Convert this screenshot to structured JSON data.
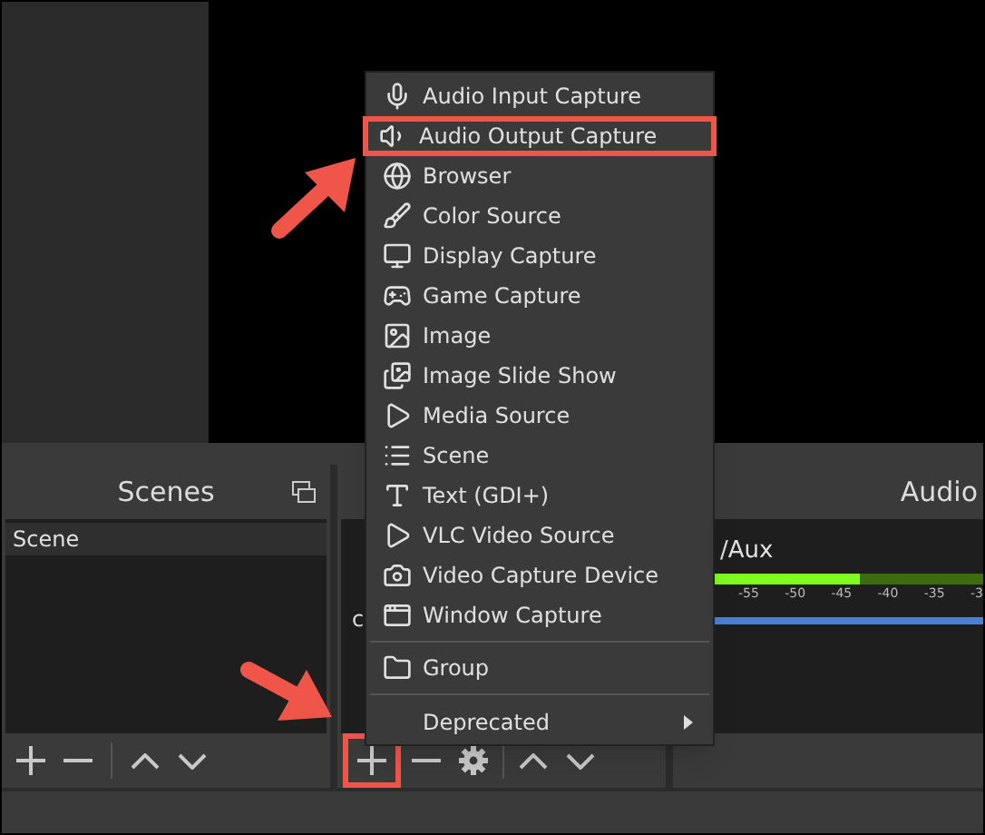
{
  "scenes": {
    "title": "Scenes",
    "items": [
      {
        "label": "Scene",
        "selected": true
      }
    ]
  },
  "sources": {
    "items": [
      "c"
    ],
    "add_highlighted": true
  },
  "audio": {
    "title": "Audio",
    "channel": {
      "name": "/Aux",
      "level": 0.6,
      "volume": {
        "level": 1
      },
      "ticks": [
        "-55",
        "-50",
        "-45",
        "-40",
        "-35",
        "-3"
      ]
    }
  },
  "menu": {
    "items": [
      {
        "kind": "item",
        "label": "Audio Input Capture",
        "highlighted": false
      },
      {
        "kind": "item",
        "label": "Audio Output Capture",
        "highlighted": true
      },
      {
        "kind": "item",
        "label": "Browser",
        "highlighted": false
      },
      {
        "kind": "item",
        "label": "Color Source",
        "highlighted": false
      },
      {
        "kind": "item",
        "label": "Display Capture",
        "highlighted": false
      },
      {
        "kind": "item",
        "label": "Game Capture",
        "highlighted": false
      },
      {
        "kind": "item",
        "label": "Image",
        "highlighted": false
      },
      {
        "kind": "item",
        "label": "Image Slide Show",
        "highlighted": false
      },
      {
        "kind": "item",
        "label": "Media Source",
        "highlighted": false
      },
      {
        "kind": "item",
        "label": "Scene",
        "highlighted": false
      },
      {
        "kind": "item",
        "label": "Text (GDI+)",
        "highlighted": false
      },
      {
        "kind": "item",
        "label": "VLC Video Source",
        "highlighted": false
      },
      {
        "kind": "item",
        "label": "Video Capture Device",
        "highlighted": false
      },
      {
        "kind": "item",
        "label": "Window Capture",
        "highlighted": false
      },
      {
        "kind": "separator"
      },
      {
        "kind": "item",
        "label": "Group",
        "highlighted": false
      },
      {
        "kind": "separator"
      },
      {
        "kind": "submenu",
        "label": "Deprecated",
        "highlighted": false
      }
    ]
  }
}
